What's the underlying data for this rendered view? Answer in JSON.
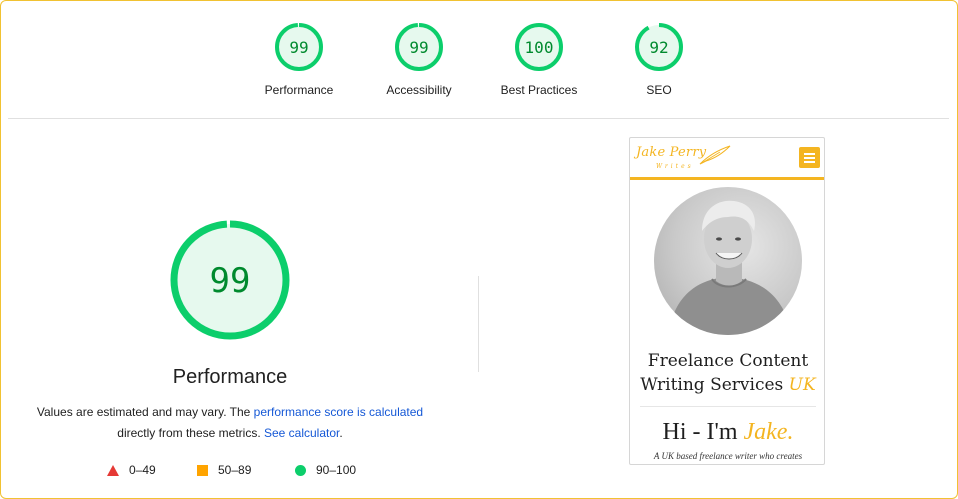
{
  "categories": [
    {
      "label": "Performance",
      "score": "99",
      "value": 99
    },
    {
      "label": "Accessibility",
      "score": "99",
      "value": 99
    },
    {
      "label": "Best Practices",
      "score": "100",
      "value": 100
    },
    {
      "label": "SEO",
      "score": "92",
      "value": 92
    }
  ],
  "main": {
    "score": "99",
    "value": 99,
    "title": "Performance",
    "desc_prefix": "Values are estimated and may vary. The ",
    "desc_link1": "performance score is calculated",
    "desc_middle": " directly from these metrics. ",
    "desc_link2": "See calculator",
    "desc_suffix": "."
  },
  "legend": {
    "fail": "0–49",
    "average": "50–89",
    "pass": "90–100"
  },
  "colors": {
    "pass": "#0cce6b",
    "pass_text": "#008a2e",
    "pass_bg": "#e6f9ee",
    "average": "#ffa400",
    "fail": "#e53935",
    "brand_yellow": "#f4b521",
    "frame_border": "#f1c232"
  },
  "screenshot": {
    "logo": "Jake Perry",
    "logo_sub": "Writes",
    "menu_icon": "hamburger-icon",
    "heading_line1": "Freelance Content",
    "heading_line2_a": "Writing Services ",
    "heading_line2_b": "UK",
    "hi_a": "Hi - I'm ",
    "hi_b": "Jake.",
    "subline": "A UK based freelance writer who creates"
  }
}
